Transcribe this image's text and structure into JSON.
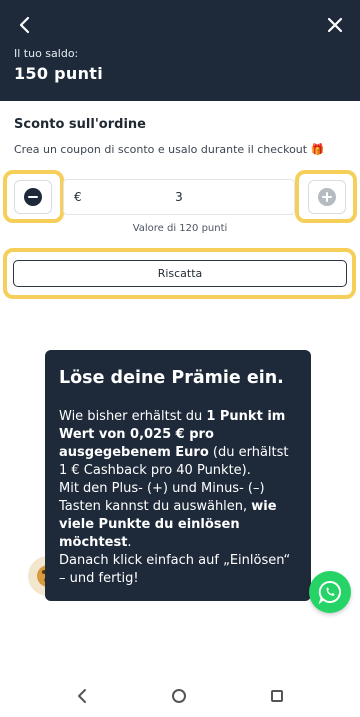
{
  "header": {
    "balance_label": "Il tuo saldo:",
    "balance_value": "150 punti"
  },
  "discount": {
    "title": "Sconto sull'ordine",
    "subtitle": "Crea un coupon di sconto e usalo durante il checkout",
    "subtitle_emoji": "🎁",
    "currency": "€",
    "amount": "3",
    "points_caption": "Valore di 120 punti",
    "redeem_label": "Riscatta"
  },
  "tooltip": {
    "title": "Löse deine Prämie ein.",
    "p1_a": "Wie bisher erhältst du ",
    "p1_b": "1 Punkt im Wert von 0,025 € pro ausgegebenem Euro",
    "p1_c": " (du erhältst 1 € Cashback pro 40 Punkte).",
    "p2_a": "Mit den Plus- (+) und Minus- (–) Tasten kannst du auswählen, ",
    "p2_b": "wie viele Punkte du einlösen möchtest",
    "p2_c": ".",
    "p3": "Danach klick einfach auf „Einlösen“ – und fertig!"
  },
  "icons": {
    "back": "chevron-left-icon",
    "close": "close-icon",
    "minus": "minus-circle-icon",
    "plus": "plus-circle-icon",
    "cookie": "cookie-icon",
    "whatsapp": "whatsapp-icon"
  },
  "colors": {
    "header_bg": "#1e2a3a",
    "highlight": "#f6cf5a",
    "whatsapp": "#25d366"
  }
}
